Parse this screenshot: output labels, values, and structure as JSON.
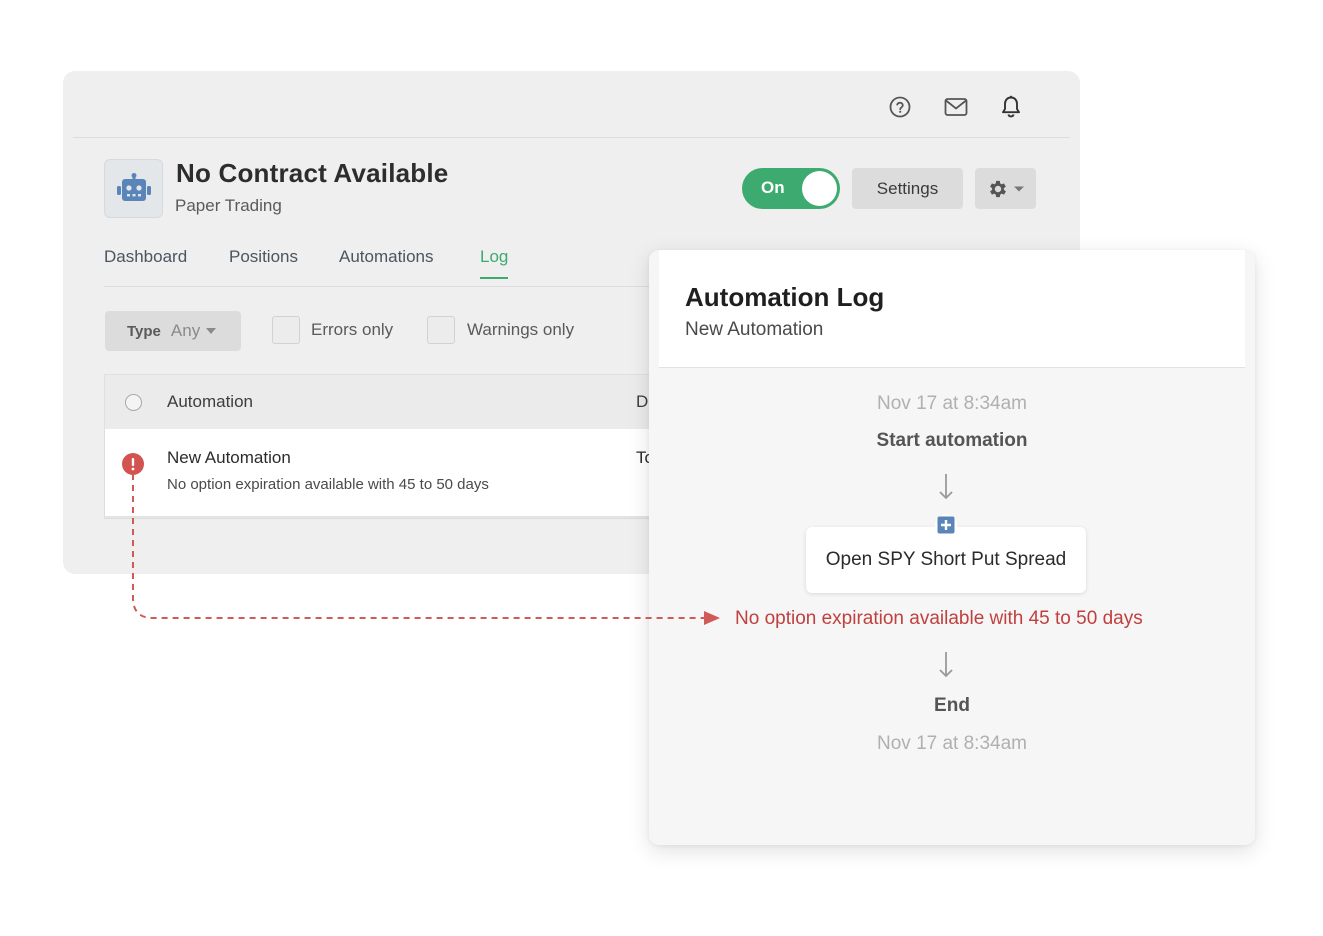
{
  "colors": {
    "accent_green": "#3daa6f",
    "error_red": "#d25350",
    "robot_blue": "#5a85b9",
    "action_blue": "#5a85b9"
  },
  "topbar": {
    "icons": [
      "help-circle-icon",
      "mail-icon",
      "bell-icon"
    ]
  },
  "bot": {
    "title": "No Contract Available",
    "subtitle": "Paper Trading",
    "toggle_label": "On",
    "settings_label": "Settings",
    "avatar_icon": "robot-icon"
  },
  "tabs": [
    {
      "label": "Dashboard",
      "active": false
    },
    {
      "label": "Positions",
      "active": false
    },
    {
      "label": "Automations",
      "active": false
    },
    {
      "label": "Log",
      "active": true
    }
  ],
  "filters": {
    "type_label": "Type",
    "type_value": "Any",
    "errors_only": "Errors only",
    "warnings_only": "Warnings only"
  },
  "table": {
    "columns": [
      "Automation",
      "D"
    ],
    "rows": [
      {
        "title": "New Automation",
        "message": "No option expiration available with 45 to 50 days",
        "col2": "To",
        "status": "error"
      }
    ]
  },
  "panel": {
    "title": "Automation Log",
    "subtitle": "New Automation",
    "start_time": "Nov 17 at 8:34am",
    "start_label": "Start automation",
    "action_label": "Open SPY Short Put Spread",
    "error_message": "No option expiration available with 45 to 50 days",
    "end_label": "End",
    "end_time": "Nov 17 at 8:34am"
  }
}
